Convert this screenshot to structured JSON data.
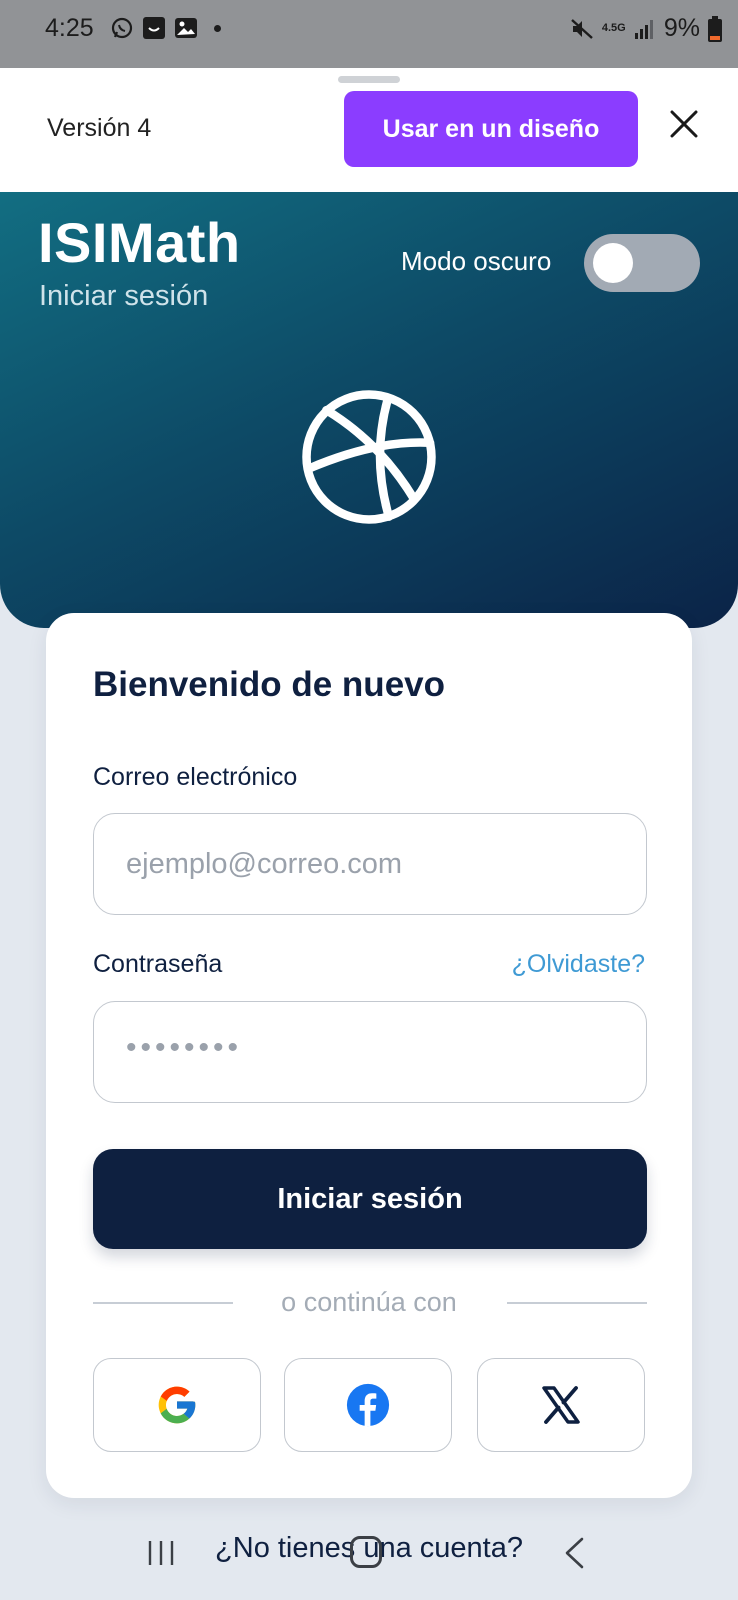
{
  "status_bar": {
    "time": "4:25",
    "left_icons": [
      "whatsapp-icon",
      "app-icon",
      "gallery-icon",
      "dot"
    ],
    "right_icons": [
      "mute-icon",
      "network-icon",
      "signal-icon"
    ],
    "network": "4.5G",
    "battery": "9%"
  },
  "sheet": {
    "version_label": "Versión 4",
    "use_design_label": "Usar en un diseño",
    "accent_color": "#8b3dff"
  },
  "hero": {
    "title": "ISIMath",
    "subtitle": "Iniciar sesión",
    "dark_mode_label": "Modo oscuro",
    "dark_mode_on": false,
    "logo_icon": "basketball-icon"
  },
  "card": {
    "welcome": "Bienvenido de nuevo",
    "email": {
      "label": "Correo electrónico",
      "placeholder": "ejemplo@correo.com",
      "value": ""
    },
    "password": {
      "label": "Contraseña",
      "forgot": "¿Olvidaste?",
      "masked_value": "••••••••"
    },
    "login_button": "Iniciar sesión",
    "divider_text": "o continúa con",
    "social": [
      "google-icon",
      "facebook-icon",
      "x-icon"
    ]
  },
  "footer": {
    "no_account": "¿No tienes una cuenta?"
  },
  "colors": {
    "primary": "#0e2040",
    "link": "#3f9ad4"
  }
}
